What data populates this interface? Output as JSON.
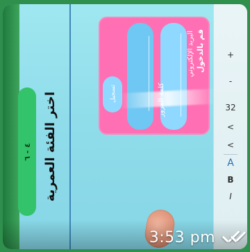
{
  "overlay": {
    "time": "3:53 pm",
    "read_receipt_icon": "double-check-icon"
  },
  "left_panel": {
    "title": "اختر الفئة العمرية",
    "button_label": "٤ - ٦"
  },
  "card": {
    "title": "قم بالدخول",
    "label_one": "البريد الإلكتروني",
    "label_two": "كلمة المرور",
    "button_text": "تسجيل"
  },
  "toolbar": {
    "items": [
      "+",
      "-",
      "32",
      "<",
      "<",
      "A",
      "B",
      "I"
    ]
  },
  "colors": {
    "background": "#2f8f4c",
    "screen": "#8fdcea",
    "card": "#ff6fb3",
    "button": "#33c36a"
  }
}
